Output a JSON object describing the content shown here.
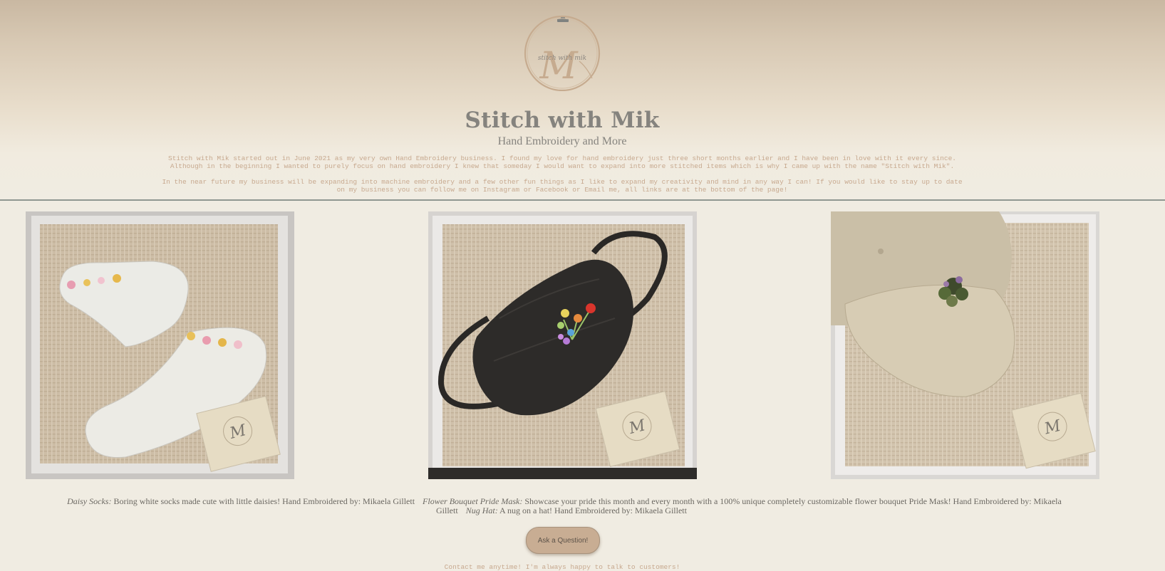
{
  "header": {
    "logo_text": "stitch with mik",
    "logo_monogram": "M",
    "title": "Stitch with Mik",
    "subtitle": "Hand Embroidery and More"
  },
  "intro": {
    "paragraph_1": "Stitch with Mik started out in June 2021 as my very own Hand Embroidery business. I found my love for hand embroidery just three short months earlier and I have been in love with it every since. Although in the beginning I wanted to purely focus on hand embroidery I knew that someday I would want to expand into more stitched items which is why I came up with the name \"Stitch with Mik\".",
    "paragraph_2": "In the near future my business will be expanding into machine embroidery and a few other fun things as I like to expand my creativity and mind in any way I can! If you would like to stay up to date on my business you can follow me on Instagram or Facebook or Email me, all links are at the bottom of the page!"
  },
  "products": [
    {
      "name": "Daisy Socks:",
      "description": "Boring white socks made cute with little daisies! Hand Embroidered by: Mikaela Gillett"
    },
    {
      "name": "Flower Bouquet Pride Mask:",
      "description": "Showcase your pride this month and every month with a 100% unique completely customizable flower bouquet Pride Mask! Hand Embroidered by: Mikaela Gillett"
    },
    {
      "name": "Nug Hat:",
      "description": "A nug on a hat! Hand Embroidered by: Mikaela Gillett"
    }
  ],
  "ask_button": {
    "label": "Ask a Question!"
  },
  "contact": {
    "text": "Contact me anytime! I'm always happy to talk to customers!"
  },
  "colors": {
    "background": "#f0ece2",
    "header_top": "#c9b8a2",
    "title_gray": "#85837e",
    "intro_text": "#c7a98f",
    "button": "#c8ad93",
    "divider": "#8f9791"
  },
  "icons": {
    "logo": "embroidery-hoop-logo-icon"
  }
}
